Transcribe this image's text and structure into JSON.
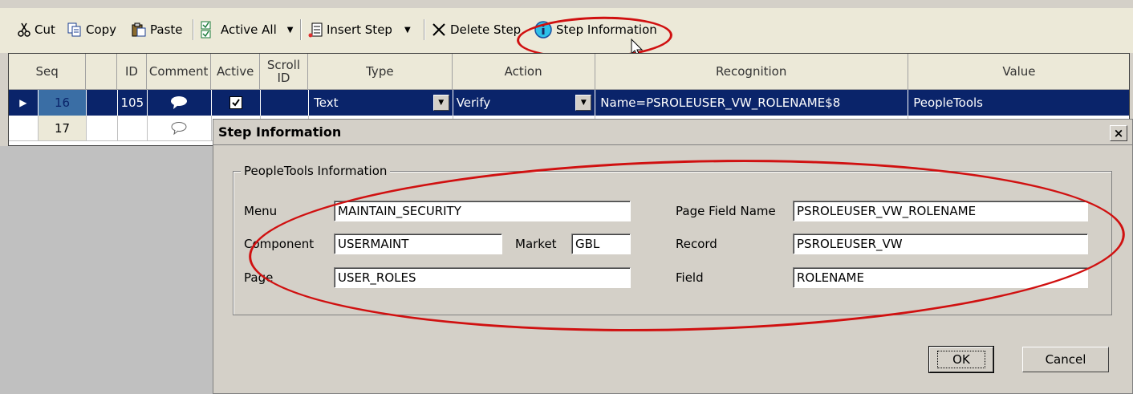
{
  "toolbar": {
    "cut": "Cut",
    "copy": "Copy",
    "paste": "Paste",
    "active_all": "Active All",
    "insert_step": "Insert Step",
    "delete_step": "Delete Step",
    "step_information": "Step Information"
  },
  "grid": {
    "headers": {
      "seq": "Seq",
      "id": "ID",
      "comment": "Comment",
      "active": "Active",
      "scroll_id": "Scroll ID",
      "type": "Type",
      "action": "Action",
      "recognition": "Recognition",
      "value": "Value"
    },
    "rows": [
      {
        "seq": "16",
        "id": "105",
        "active": true,
        "type": "Text",
        "action": "Verify",
        "recognition": "Name=PSROLEUSER_VW_ROLENAME$8",
        "value": "PeopleTools",
        "selected": true
      },
      {
        "seq": "17",
        "id": "",
        "active": false,
        "type": "",
        "action": "",
        "recognition": "",
        "value": "",
        "selected": false
      }
    ]
  },
  "dialog": {
    "title": "Step Information",
    "group_title": "PeopleTools Information",
    "labels": {
      "menu": "Menu",
      "component": "Component",
      "market": "Market",
      "page": "Page",
      "page_field_name": "Page Field Name",
      "record": "Record",
      "field": "Field"
    },
    "values": {
      "menu": "MAINTAIN_SECURITY",
      "component": "USERMAINT",
      "market": "GBL",
      "page": "USER_ROLES",
      "page_field_name": "PSROLEUSER_VW_ROLENAME",
      "record": "PSROLEUSER_VW",
      "field": "ROLENAME"
    },
    "ok": "OK",
    "cancel": "Cancel",
    "close": "×"
  },
  "colors": {
    "selection": "#0a246a",
    "annotation": "#d01010"
  }
}
